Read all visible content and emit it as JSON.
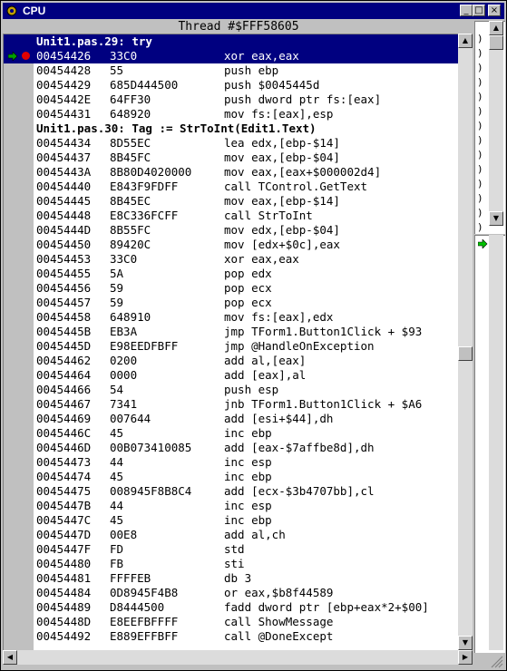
{
  "window": {
    "title": "CPU"
  },
  "thread_label": "Thread #$FFF58605",
  "colors": {
    "selection": "#000080",
    "breakpoint": "#e00000",
    "cpu_arrow": "#00a000"
  },
  "disasm": [
    {
      "type": "src",
      "text": "Unit1.pas.29: try",
      "selected": true
    },
    {
      "type": "ins",
      "addr": "00454426",
      "bytes": "33C0",
      "instr": "xor eax,eax",
      "selected": true,
      "current": true,
      "breakpoint": true
    },
    {
      "type": "ins",
      "addr": "00454428",
      "bytes": "55",
      "instr": "push ebp"
    },
    {
      "type": "ins",
      "addr": "00454429",
      "bytes": "685D444500",
      "instr": "push $0045445d"
    },
    {
      "type": "ins",
      "addr": "0045442E",
      "bytes": "64FF30",
      "instr": "push dword ptr fs:[eax]"
    },
    {
      "type": "ins",
      "addr": "00454431",
      "bytes": "648920",
      "instr": "mov fs:[eax],esp"
    },
    {
      "type": "src",
      "text": "Unit1.pas.30: Tag := StrToInt(Edit1.Text)"
    },
    {
      "type": "ins",
      "addr": "00454434",
      "bytes": "8D55EC",
      "instr": "lea edx,[ebp-$14]"
    },
    {
      "type": "ins",
      "addr": "00454437",
      "bytes": "8B45FC",
      "instr": "mov eax,[ebp-$04]"
    },
    {
      "type": "ins",
      "addr": "0045443A",
      "bytes": "8B80D4020000",
      "instr": "mov eax,[eax+$000002d4]"
    },
    {
      "type": "ins",
      "addr": "00454440",
      "bytes": "E843F9FDFF",
      "instr": "call TControl.GetText"
    },
    {
      "type": "ins",
      "addr": "00454445",
      "bytes": "8B45EC",
      "instr": "mov eax,[ebp-$14]"
    },
    {
      "type": "ins",
      "addr": "00454448",
      "bytes": "E8C336FCFF",
      "instr": "call StrToInt"
    },
    {
      "type": "ins",
      "addr": "0045444D",
      "bytes": "8B55FC",
      "instr": "mov edx,[ebp-$04]"
    },
    {
      "type": "ins",
      "addr": "00454450",
      "bytes": "89420C",
      "instr": "mov [edx+$0c],eax"
    },
    {
      "type": "ins",
      "addr": "00454453",
      "bytes": "33C0",
      "instr": "xor eax,eax"
    },
    {
      "type": "ins",
      "addr": "00454455",
      "bytes": "5A",
      "instr": "pop edx"
    },
    {
      "type": "ins",
      "addr": "00454456",
      "bytes": "59",
      "instr": "pop ecx"
    },
    {
      "type": "ins",
      "addr": "00454457",
      "bytes": "59",
      "instr": "pop ecx"
    },
    {
      "type": "ins",
      "addr": "00454458",
      "bytes": "648910",
      "instr": "mov fs:[eax],edx"
    },
    {
      "type": "ins",
      "addr": "0045445B",
      "bytes": "EB3A",
      "instr": "jmp TForm1.Button1Click + $93"
    },
    {
      "type": "ins",
      "addr": "0045445D",
      "bytes": "E98EEDFBFF",
      "instr": "jmp @HandleOnException"
    },
    {
      "type": "ins",
      "addr": "00454462",
      "bytes": "0200",
      "instr": "add al,[eax]"
    },
    {
      "type": "ins",
      "addr": "00454464",
      "bytes": "0000",
      "instr": "add [eax],al"
    },
    {
      "type": "ins",
      "addr": "00454466",
      "bytes": "54",
      "instr": "push esp"
    },
    {
      "type": "ins",
      "addr": "00454467",
      "bytes": "7341",
      "instr": "jnb TForm1.Button1Click + $A6"
    },
    {
      "type": "ins",
      "addr": "00454469",
      "bytes": "007644",
      "instr": "add [esi+$44],dh"
    },
    {
      "type": "ins",
      "addr": "0045446C",
      "bytes": "45",
      "instr": "inc ebp"
    },
    {
      "type": "ins",
      "addr": "0045446D",
      "bytes": "00B073410085",
      "instr": "add [eax-$7affbe8d],dh"
    },
    {
      "type": "ins",
      "addr": "00454473",
      "bytes": "44",
      "instr": "inc esp"
    },
    {
      "type": "ins",
      "addr": "00454474",
      "bytes": "45",
      "instr": "inc ebp"
    },
    {
      "type": "ins",
      "addr": "00454475",
      "bytes": "008945F8B8C4",
      "instr": "add [ecx-$3b4707bb],cl"
    },
    {
      "type": "ins",
      "addr": "0045447B",
      "bytes": "44",
      "instr": "inc esp"
    },
    {
      "type": "ins",
      "addr": "0045447C",
      "bytes": "45",
      "instr": "inc ebp"
    },
    {
      "type": "ins",
      "addr": "0045447D",
      "bytes": "00E8",
      "instr": "add al,ch"
    },
    {
      "type": "ins",
      "addr": "0045447F",
      "bytes": "FD",
      "instr": "std"
    },
    {
      "type": "ins",
      "addr": "00454480",
      "bytes": "FB",
      "instr": "sti"
    },
    {
      "type": "ins",
      "addr": "00454481",
      "bytes": "FFFFEB",
      "instr": "db 3"
    },
    {
      "type": "ins",
      "addr": "00454484",
      "bytes": "0D8945F4B8",
      "instr": "or eax,$b8f44589"
    },
    {
      "type": "ins",
      "addr": "00454489",
      "bytes": "D8444500",
      "instr": "fadd dword ptr [ebp+eax*2+$00]"
    },
    {
      "type": "ins",
      "addr": "0045448D",
      "bytes": "E8EEFBFFFF",
      "instr": "call ShowMessage"
    },
    {
      "type": "ins",
      "addr": "00454492",
      "bytes": "E889EFFBFF",
      "instr": "call @DoneExcept"
    }
  ],
  "right_panel": {
    "lines": [
      ")",
      ")",
      ")",
      ")",
      ")",
      ")",
      ")",
      ")",
      ")",
      ")",
      ")",
      ")",
      ")",
      ")"
    ]
  },
  "scroll": {
    "disasm_position": 0.52
  }
}
